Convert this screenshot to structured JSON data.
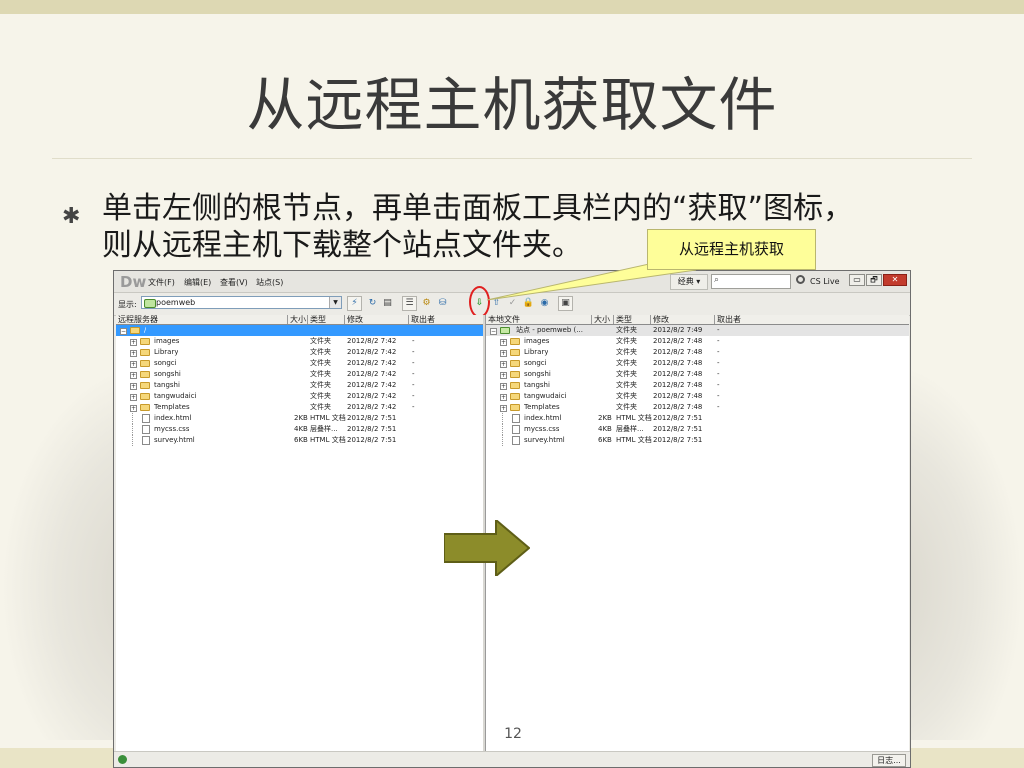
{
  "slide": {
    "title": "从远程主机获取文件",
    "bullet_marker": "✱",
    "bullet_line1": "单击左侧的根节点，再单击面板工具栏内的“获取”图标，",
    "bullet_line2": "则从远程主机下载整个站点文件夹。",
    "callout": "从远程主机获取",
    "page_number": "12"
  },
  "dw": {
    "logo": "Dw",
    "menus": [
      "文件(F)",
      "编辑(E)",
      "查看(V)",
      "站点(S)"
    ],
    "workspace": "经典 ▾",
    "cslive": "CS Live",
    "window_buttons": [
      "▭",
      "🗗",
      "✕"
    ],
    "show_label": "显示:",
    "site_name": "poemweb",
    "status_button": "日志...",
    "toolbar_icons": [
      "connect-icon",
      "refresh-icon",
      "log-icon",
      "view-files-icon",
      "testing-server-icon",
      "repository-icon",
      "get-icon",
      "put-icon",
      "checkout-icon",
      "checkin-icon",
      "sync-icon",
      "expand-icon"
    ]
  },
  "remote": {
    "headers": [
      "远程服务器",
      "大小",
      "类型",
      "修改",
      "取出者"
    ],
    "root": {
      "name": "/",
      "selected": true
    },
    "folders": [
      {
        "name": "images",
        "type": "文件夹",
        "modified": "2012/8/2 7:42",
        "checkedout": "-"
      },
      {
        "name": "Library",
        "type": "文件夹",
        "modified": "2012/8/2 7:42",
        "checkedout": "-"
      },
      {
        "name": "songci",
        "type": "文件夹",
        "modified": "2012/8/2 7:42",
        "checkedout": "-"
      },
      {
        "name": "songshi",
        "type": "文件夹",
        "modified": "2012/8/2 7:42",
        "checkedout": "-"
      },
      {
        "name": "tangshi",
        "type": "文件夹",
        "modified": "2012/8/2 7:42",
        "checkedout": "-"
      },
      {
        "name": "tangwudaici",
        "type": "文件夹",
        "modified": "2012/8/2 7:42",
        "checkedout": "-"
      },
      {
        "name": "Templates",
        "type": "文件夹",
        "modified": "2012/8/2 7:42",
        "checkedout": "-"
      }
    ],
    "files": [
      {
        "name": "index.html",
        "size": "2KB",
        "type": "HTML 文档",
        "modified": "2012/8/2 7:51"
      },
      {
        "name": "mycss.css",
        "size": "4KB",
        "type": "层叠样...",
        "modified": "2012/8/2 7:51"
      },
      {
        "name": "survey.html",
        "size": "6KB",
        "type": "HTML 文档",
        "modified": "2012/8/2 7:51"
      }
    ]
  },
  "local": {
    "headers": [
      "本地文件",
      "大小",
      "类型",
      "修改",
      "取出者"
    ],
    "root": {
      "name": "站点 - poemweb (...",
      "type": "文件夹",
      "modified": "2012/8/2 7:49",
      "checkedout": "-"
    },
    "folders": [
      {
        "name": "images",
        "type": "文件夹",
        "modified": "2012/8/2 7:48",
        "checkedout": "-"
      },
      {
        "name": "Library",
        "type": "文件夹",
        "modified": "2012/8/2 7:48",
        "checkedout": "-"
      },
      {
        "name": "songci",
        "type": "文件夹",
        "modified": "2012/8/2 7:48",
        "checkedout": "-"
      },
      {
        "name": "songshi",
        "type": "文件夹",
        "modified": "2012/8/2 7:48",
        "checkedout": "-"
      },
      {
        "name": "tangshi",
        "type": "文件夹",
        "modified": "2012/8/2 7:48",
        "checkedout": "-"
      },
      {
        "name": "tangwudaici",
        "type": "文件夹",
        "modified": "2012/8/2 7:48",
        "checkedout": "-"
      },
      {
        "name": "Templates",
        "type": "文件夹",
        "modified": "2012/8/2 7:48",
        "checkedout": "-"
      }
    ],
    "files": [
      {
        "name": "index.html",
        "size": "2KB",
        "type": "HTML 文档",
        "modified": "2012/8/2 7:51"
      },
      {
        "name": "mycss.css",
        "size": "4KB",
        "type": "层叠样...",
        "modified": "2012/8/2 7:51"
      },
      {
        "name": "survey.html",
        "size": "6KB",
        "type": "HTML 文档",
        "modified": "2012/8/2 7:51"
      }
    ]
  },
  "colors": {
    "arrow_fill": "#8c8c2a",
    "arrow_stroke": "#5e5e17",
    "highlight_ring": "#e02020",
    "callout_bg": "#fefe99",
    "selection": "#3399ff"
  }
}
